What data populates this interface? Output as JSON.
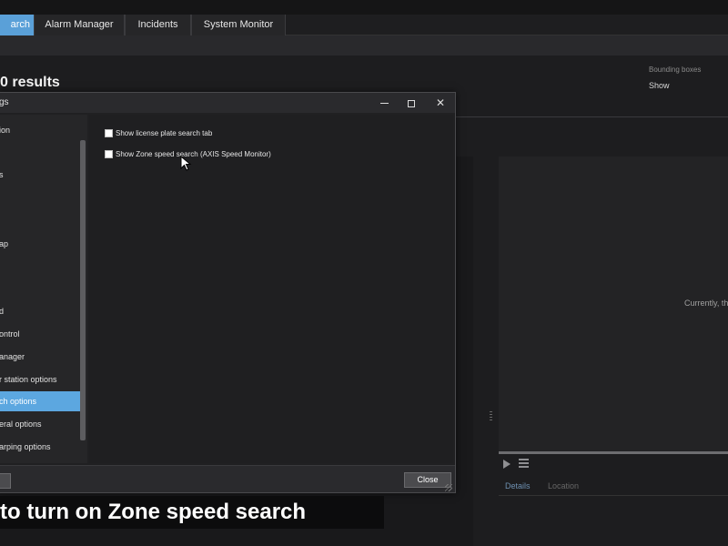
{
  "tabs": [
    {
      "label": "arch",
      "active": true
    },
    {
      "label": "Alarm Manager",
      "active": false
    },
    {
      "label": "Incidents",
      "active": false
    },
    {
      "label": "System Monitor",
      "active": false
    }
  ],
  "results": {
    "title": "0 results",
    "bounding_boxes_label": "Bounding boxes",
    "bounding_boxes_value": "Show"
  },
  "preview": {
    "message": "Currently, th",
    "tabs": [
      "Details",
      "Location"
    ]
  },
  "dialog": {
    "title": "gs",
    "nav_items": [
      {
        "label": "ion",
        "selected": false
      },
      {
        "label": "s",
        "selected": false
      },
      {
        "label": "ap",
        "selected": false
      },
      {
        "label": "d",
        "selected": false
      },
      {
        "label": "ontrol",
        "selected": false
      },
      {
        "label": "anager",
        "selected": false
      },
      {
        "label": "r station options",
        "selected": false
      },
      {
        "label": "ch options",
        "selected": true
      },
      {
        "label": "eral options",
        "selected": false
      },
      {
        "label": "arping options",
        "selected": false
      }
    ],
    "options": [
      {
        "label": "Show license plate search tab",
        "checked": false
      },
      {
        "label": "Show Zone speed search (AXIS Speed Monitor)",
        "checked": false
      }
    ],
    "close_label": "Close"
  },
  "caption": "to turn on Zone speed search",
  "colors": {
    "accent": "#5ca7e0",
    "background": "#1b1b1d"
  }
}
